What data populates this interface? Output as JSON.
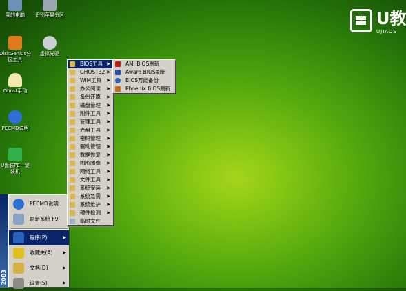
{
  "desktop": {
    "icons": [
      {
        "label": "我的电脑",
        "color": "#6c8fb8"
      },
      {
        "label": "识别苹果分区",
        "color": "#9aa6b4"
      },
      {
        "label": "DiskGenius分\n区工具",
        "color": "#e07a1a"
      },
      {
        "label": "虚拟光驱",
        "color": "#c9cfd6"
      },
      {
        "label": "Ghost手动",
        "color": "#f2e9b0"
      },
      {
        "label": "PECMD说明",
        "color": "#2d6fd6"
      },
      {
        "label": "U盘装PE一键\n装机",
        "color": "#2fb04a"
      }
    ]
  },
  "brand": {
    "name": "U教",
    "sub": "UJIAOS"
  },
  "start_menu": {
    "side_text": "2003",
    "items": [
      {
        "label": "PECMD说明",
        "color": "#2d6fd6"
      },
      {
        "label": "刷新系统 F9",
        "color": "#8aa3c4"
      },
      {
        "label": "程序(P)",
        "color": "#2a62c0"
      },
      {
        "label": "收藏夹(A)",
        "color": "#e0c020"
      },
      {
        "label": "文档(D)",
        "color": "#d8b040"
      },
      {
        "label": "设置(S)",
        "color": "#8a8a8a"
      }
    ]
  },
  "programs_menu": {
    "items": [
      {
        "label": "BIOS工具",
        "submenu": true
      },
      {
        "label": "GHOST32",
        "submenu": true
      },
      {
        "label": "WIM工具",
        "submenu": true
      },
      {
        "label": "办公阅读",
        "submenu": true
      },
      {
        "label": "备份还原",
        "submenu": true
      },
      {
        "label": "磁盘管理",
        "submenu": true
      },
      {
        "label": "附件工具",
        "submenu": true
      },
      {
        "label": "管理工具",
        "submenu": true
      },
      {
        "label": "光盘工具",
        "submenu": true
      },
      {
        "label": "密码管理",
        "submenu": true
      },
      {
        "label": "驱动管理",
        "submenu": true
      },
      {
        "label": "数据恢复",
        "submenu": true
      },
      {
        "label": "图形图像",
        "submenu": true
      },
      {
        "label": "网络工具",
        "submenu": true
      },
      {
        "label": "文件工具",
        "submenu": true
      },
      {
        "label": "系统安装",
        "submenu": true
      },
      {
        "label": "系统急需",
        "submenu": true
      },
      {
        "label": "系统维护",
        "submenu": true
      },
      {
        "label": "硬件检测",
        "submenu": true
      },
      {
        "label": "临时文件",
        "submenu": false
      }
    ]
  },
  "bios_menu": {
    "items": [
      {
        "label": "AMI BIOS刷新",
        "color": "#c02020"
      },
      {
        "label": "Award BIOS刷新",
        "color": "#2a4fa0"
      },
      {
        "label": "BIOS万能备份",
        "color": "#2a62c0"
      },
      {
        "label": "Phoenix BIOS刷新",
        "color": "#c07020"
      }
    ]
  }
}
